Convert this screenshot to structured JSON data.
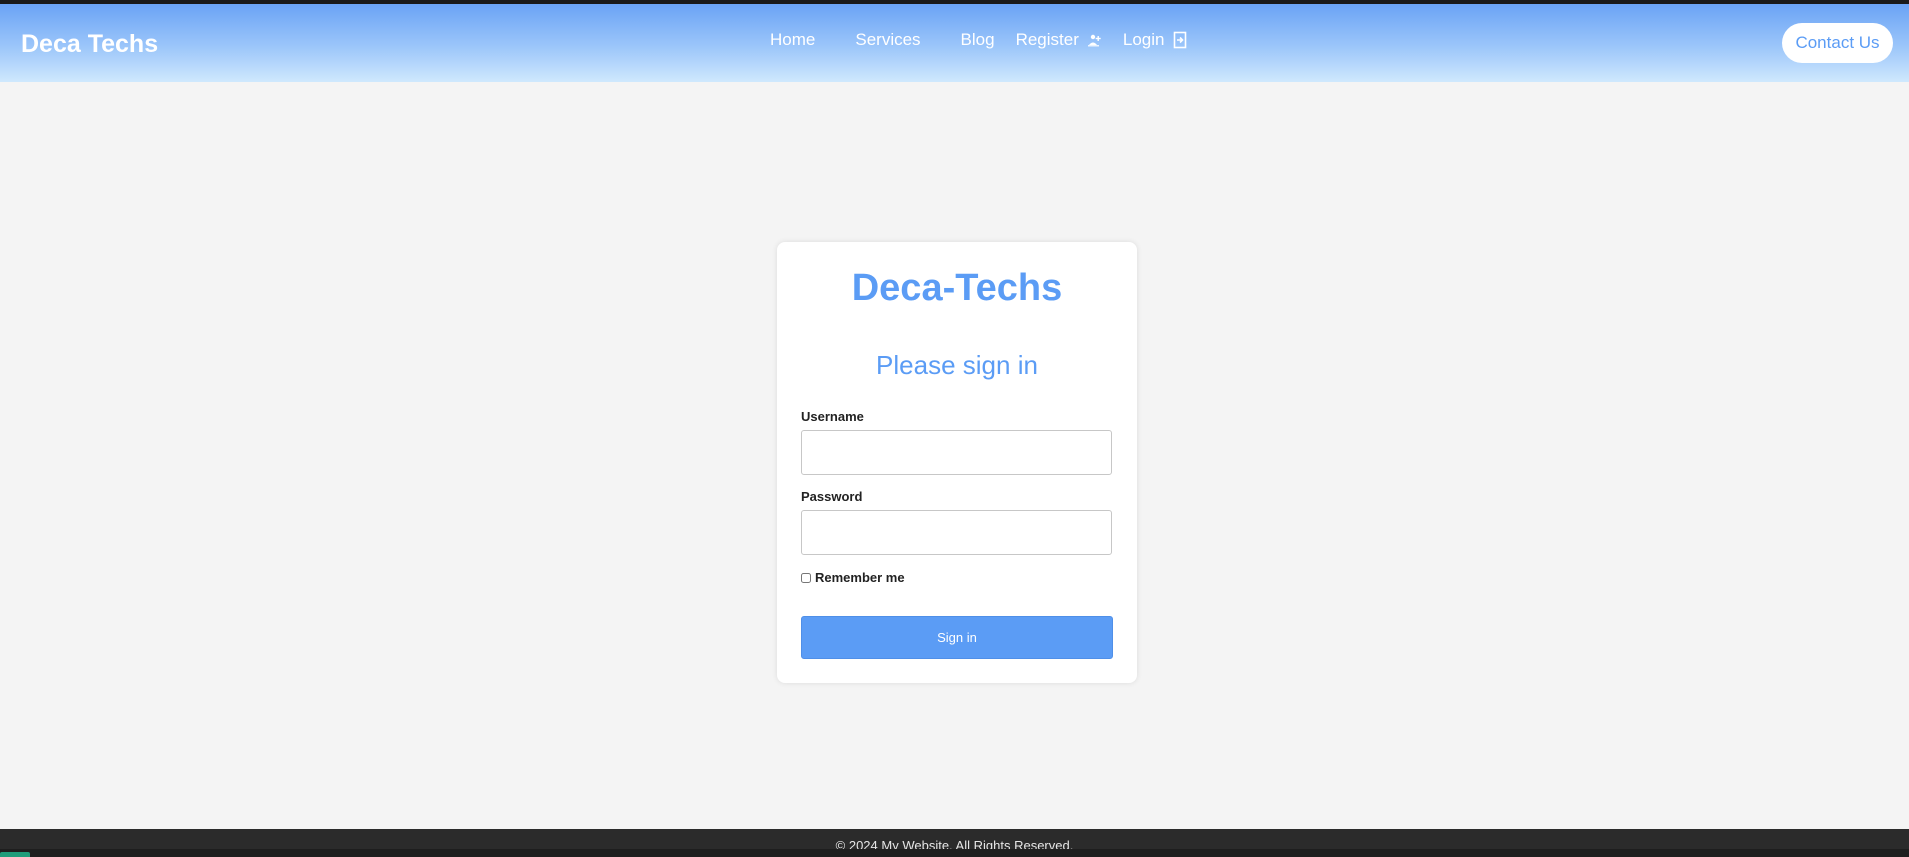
{
  "navbar": {
    "brand": "Deca Techs",
    "links": {
      "home": "Home",
      "services": "Services",
      "blog": "Blog",
      "register": "Register",
      "login": "Login"
    },
    "register_icon": "user-plus-icon",
    "login_icon": "login-door-icon",
    "contact_label": "Contact Us"
  },
  "login_card": {
    "title": "Deca-Techs",
    "subtitle": "Please sign in",
    "username_label": "Username",
    "username_value": "",
    "password_label": "Password",
    "password_value": "",
    "remember_label": "Remember me",
    "remember_checked": false,
    "submit_label": "Sign in"
  },
  "footer": {
    "text": "© 2024 My Website. All Rights Reserved."
  },
  "colors": {
    "accent": "#5b9cf5",
    "nav_gradient_top": "#6aa3f5",
    "nav_gradient_bottom": "#cfe8fd",
    "page_background": "#f4f4f4",
    "footer_background": "#2b2b2b"
  }
}
